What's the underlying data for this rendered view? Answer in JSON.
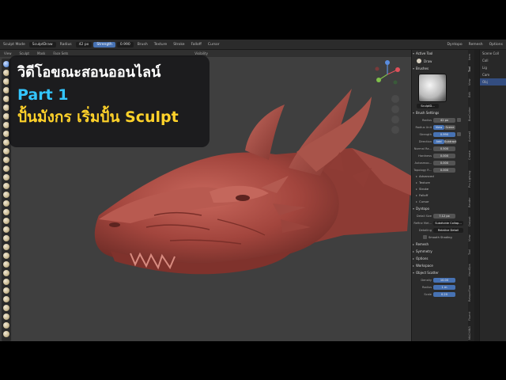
{
  "overlay": {
    "line1": "วิดีโอขณะสอนออนไลน์",
    "line2": "Part 1",
    "line3": "ปั้นมังกร เริ่มปั้น Sculpt",
    "colors": {
      "line1": "#ffffff",
      "line2": "#33c6ff",
      "line3": "#ffd22a"
    }
  },
  "header": {
    "mode": "Sculpt Mode",
    "brush_name": "SculptDraw",
    "radius": "Radius",
    "radius_value": "42 px",
    "strength": "Strength",
    "strength_value": "0.990",
    "menus": [
      "Brush",
      "Texture",
      "Stroke",
      "Falloff",
      "Cursor"
    ],
    "right_menus": [
      "Dyntopo",
      "Remesh",
      "Options"
    ]
  },
  "subheader": [
    "View",
    "Sculpt",
    "Mask",
    "Face Sets"
  ],
  "viewport_overlay_label": "Visibility",
  "properties": {
    "active_tool_section": "Active Tool",
    "active_tool": "Draw",
    "brushes_section": "Brushes",
    "brush_name": "SculptD...",
    "brush_settings_section": "Brush Settings",
    "radius_label": "Radius",
    "radius_value": "42 px",
    "radius_unit_label": "Radius Unit",
    "radius_unit_options": [
      "View",
      "Scene"
    ],
    "strength_label": "Strength",
    "strength_value": "0.990",
    "direction_label": "Direction",
    "direction_options": [
      "Add",
      "Subtract"
    ],
    "normal_radius_label": "Normal Ra...",
    "normal_radius_value": "0.500",
    "hardness_label": "Hardness",
    "hardness_value": "0.000",
    "autosmooth_label": "Autosmoo...",
    "autosmooth_value": "0.000",
    "topology_label": "Topology R...",
    "topology_value": "0.000",
    "brush_subpanels": [
      "Advanced",
      "Texture",
      "Stroke",
      "Falloff",
      "Cursor"
    ],
    "dyntopo_section": "Dyntopo",
    "detail_size_label": "Detail Size",
    "detail_size_value": "7.12 px",
    "refine_method_label": "Refine Met...",
    "refine_method_value": "Subdivide Collap...",
    "detailing_label": "Detailing",
    "detailing_value": "Relative Detail",
    "smooth_shading_label": "Smooth Shading",
    "closed_sections": [
      "Remesh",
      "Symmetry",
      "Options",
      "Workspace"
    ],
    "object_scatter_section": "Object Scatter",
    "density_label": "Density",
    "density_value": "10.00",
    "scatter_radius_label": "Radius",
    "scatter_radius_value": "1 m",
    "scale_label": "Scale",
    "scale_value": "0.20"
  },
  "tabs": [
    "Item",
    "Tool",
    "View",
    "Edit",
    "BoxCutter",
    "Animall",
    "Create",
    "Pro Lighting",
    "Render",
    "Output",
    "View",
    "Tool",
    "HardOps",
    "RetopoFlow",
    "Fluent",
    "MACHIN3"
  ],
  "outliner": {
    "items": [
      "Scene Coll",
      "Coll",
      "Lig",
      "Cam",
      "Obj"
    ]
  }
}
